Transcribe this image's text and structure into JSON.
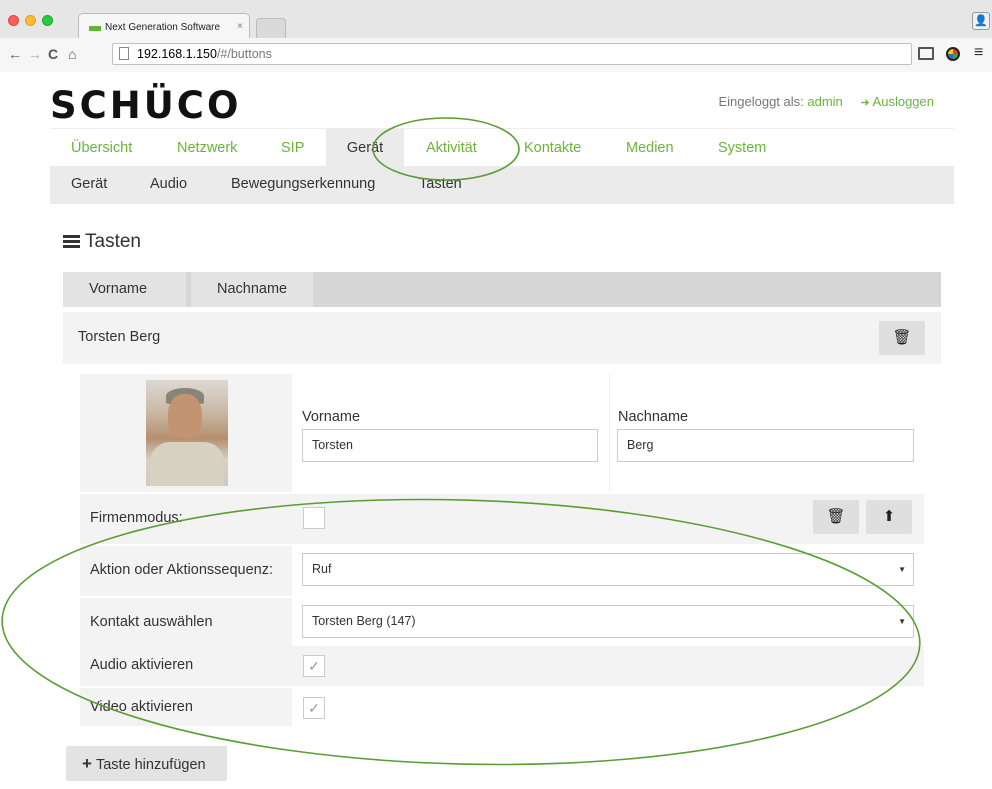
{
  "browser": {
    "tab_title": "Next Generation Software",
    "tab_close": "×",
    "url_host": "192.168.1.150",
    "url_path": "/#/buttons",
    "back": "←",
    "forward": "→",
    "reload": "C",
    "home": "⌂",
    "menu": "≡"
  },
  "header": {
    "logo": "SCHÜCO",
    "logged_in_label": "Eingeloggt als:",
    "user": "admin",
    "logout_label": "Ausloggen"
  },
  "main_nav": {
    "items": [
      "Übersicht",
      "Netzwerk",
      "SIP",
      "Gerät",
      "Aktivität",
      "Kontakte",
      "Medien",
      "System"
    ],
    "active": "Gerät"
  },
  "sub_nav": {
    "items": [
      "Gerät",
      "Audio",
      "Bewegungserkennung",
      "Tasten"
    ]
  },
  "section": {
    "title": "Tasten"
  },
  "columns": [
    "Vorname",
    "Nachname"
  ],
  "entry": {
    "display_name": "Torsten Berg",
    "vorname_label": "Vorname",
    "vorname_value": "Torsten",
    "nachname_label": "Nachname",
    "nachname_value": "Berg",
    "firmenmodus_label": "Firmenmodus:",
    "firmenmodus_checked": false,
    "aktion_label": "Aktion oder Aktionssequenz:",
    "aktion_value": "Ruf",
    "kontakt_label": "Kontakt auswählen",
    "kontakt_value": "Torsten Berg (147)",
    "audio_label": "Audio aktivieren",
    "audio_checked": true,
    "video_label": "Video aktivieren",
    "video_checked": true,
    "check_glyph": "✓"
  },
  "actions": {
    "add_button": "Taste hinzufügen",
    "add_glyph": "+"
  },
  "icons": {
    "delete": "🗑",
    "upload": "⬆",
    "logout": "➜",
    "caret": "▼"
  },
  "colors": {
    "brand_green": "#6bb43a",
    "annotation_green": "#5a9e33",
    "nav_active_bg": "#ebebeb"
  }
}
